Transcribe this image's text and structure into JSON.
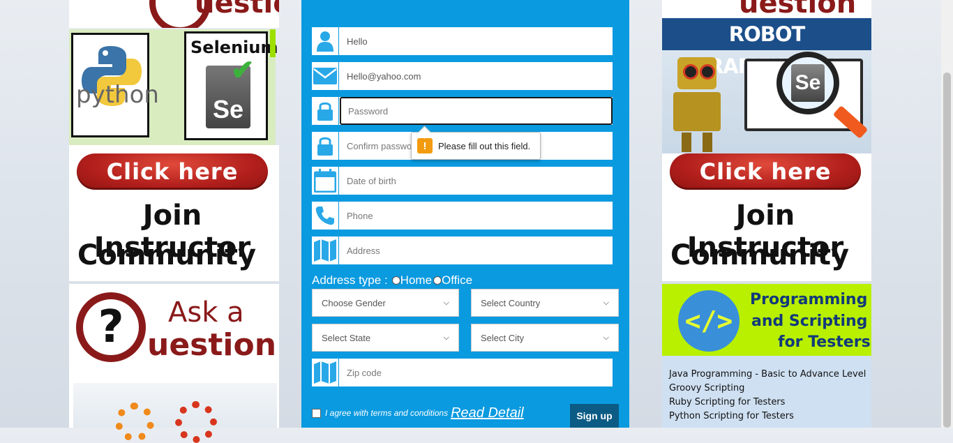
{
  "left_ads": {
    "python_label": "python",
    "selenium_label": "Selenium",
    "se_badge": "Se",
    "click_here": "Click here",
    "join_line1": "Join Instructor",
    "join_line2": "Community",
    "ask_a": "Ask a",
    "ask_question": "uestion"
  },
  "right_ads": {
    "robot_title": "ROBOT FRAMEWORK",
    "se_badge": "Se",
    "click_here": "Click here",
    "join_line1": "Join Instructor",
    "join_line2": "Community",
    "prog_line1": "Programming",
    "prog_line2": "and Scripting",
    "prog_line3": "for Testers",
    "code_glyph": "</>",
    "courses": [
      "Java Programming - Basic to Advance Level",
      "Groovy Scripting",
      "Ruby Scripting for Testers",
      "Python Scripting for Testers"
    ]
  },
  "top_question_text": "uestion",
  "form": {
    "name_value": "Hello",
    "email_value": "Hello@yahoo.com",
    "password_placeholder": "Password",
    "confirm_placeholder": "Confirm password",
    "dob_placeholder": "Date of birth",
    "phone_placeholder": "Phone",
    "address_placeholder": "Address",
    "address_type_label": "Address type :",
    "home_label": "Home",
    "office_label": "Office",
    "gender_select": "Choose Gender",
    "country_select": "Select Country",
    "state_select": "Select State",
    "city_select": "Select City",
    "zip_placeholder": "Zip code",
    "agree_text": "I agree with terms and conditions",
    "read_detail": "Read Detail",
    "signup": "Sign up"
  },
  "validation_tooltip": "Please fill out this field.",
  "colors": {
    "form_blue": "#0a9ae0",
    "icon_blue": "#29a8e8",
    "signup_bg": "#0b5b85"
  }
}
